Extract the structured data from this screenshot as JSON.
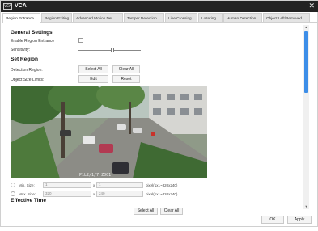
{
  "window": {
    "logo_text": "VCA",
    "title": "VCA",
    "close_glyph": "✕"
  },
  "tabs": [
    {
      "label": "Region Entrance",
      "active": true
    },
    {
      "label": "Region Exiting",
      "active": false
    },
    {
      "label": "Advanced Motion Det...",
      "active": false
    },
    {
      "label": "Tamper Detection",
      "active": false
    },
    {
      "label": "Line Crossing",
      "active": false
    },
    {
      "label": "Loitering",
      "active": false
    },
    {
      "label": "Human Detection",
      "active": false
    },
    {
      "label": "Object Left/Removed",
      "active": false
    }
  ],
  "general": {
    "heading": "General Settings",
    "enable_label": "Enable Region Entrance",
    "enable_checked": false,
    "sensitivity_label": "Sensitivity:",
    "sensitivity_value": 0.53
  },
  "region": {
    "heading": "Set Region",
    "detection_label": "Detection Region:",
    "select_all": "Select All",
    "clear_all": "Clear All",
    "size_limits_label": "Object Size Limits:",
    "edit": "Edit",
    "reset": "Reset"
  },
  "video": {
    "osd_text": "P1L2/1/7   Z001"
  },
  "sizes": {
    "min_label": "Min. Size:",
    "min_w": "1",
    "min_h": "1",
    "min_hint": "pixel(1x1~320x240)",
    "max_label": "Max. Size:",
    "max_w": "320",
    "max_h": "240",
    "max_hint": "pixel(1x1~320x240)",
    "times": "x"
  },
  "effective": {
    "heading": "Effective Time",
    "select_all": "Select All",
    "clear_all": "Clear All"
  },
  "footer": {
    "ok": "OK",
    "apply": "Apply"
  },
  "scroll": {
    "up": "▲",
    "down": "▼"
  }
}
